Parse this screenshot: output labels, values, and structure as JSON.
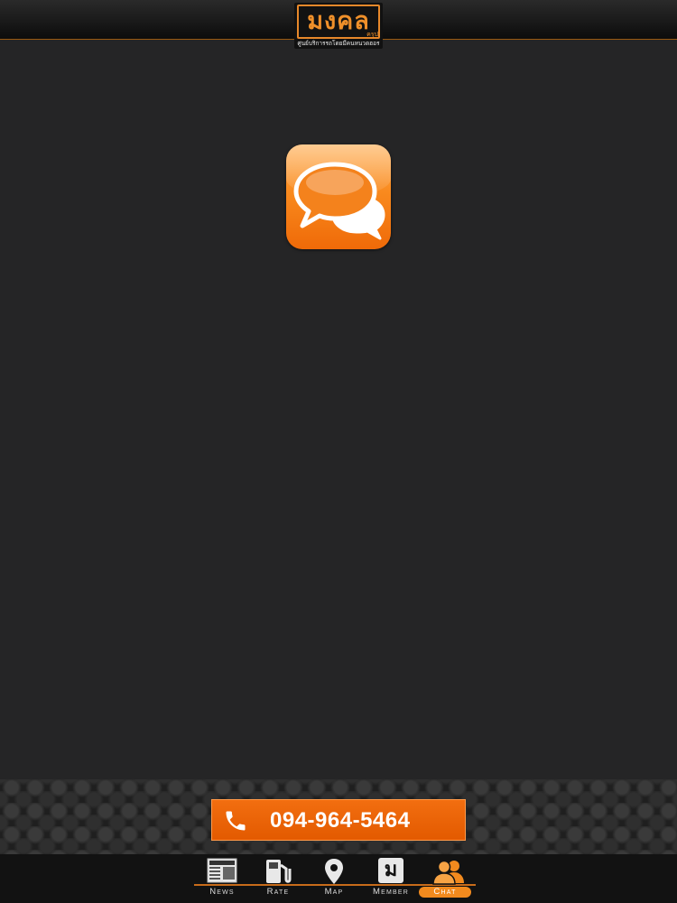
{
  "header": {
    "logo_text": "มงคล",
    "logo_small": "ครุป",
    "logo_tagline": "ศูนย์บริการรถโดยมีคนหนวดฮอร"
  },
  "contact": {
    "phone": "094-964-5464"
  },
  "tabs": [
    {
      "id": "news",
      "label": "News",
      "icon": "newspaper-icon",
      "active": false
    },
    {
      "id": "rate",
      "label": "Rate",
      "icon": "fuel-pump-icon",
      "active": false
    },
    {
      "id": "map",
      "label": "Map",
      "icon": "map-pin-icon",
      "active": false
    },
    {
      "id": "member",
      "label": "Member",
      "icon": "member-card-icon",
      "member_glyph": "ม",
      "active": false
    },
    {
      "id": "chat",
      "label": "Chat",
      "icon": "users-icon",
      "active": true
    }
  ],
  "colors": {
    "accent": "#f07a12",
    "background": "#252526",
    "tabbar": "#121212"
  }
}
